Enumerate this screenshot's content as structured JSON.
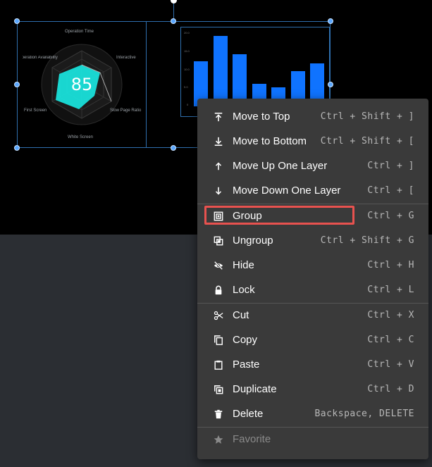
{
  "radar": {
    "score": "85",
    "labels": [
      "Operation Time",
      "Interactive",
      "Slow Page Ratio",
      "White Screen",
      "First Screen",
      "Operation Availability"
    ]
  },
  "bar_chart": {
    "y_ticks": [
      "20.0",
      "15.0",
      "10.0",
      "5.0",
      "0"
    ],
    "values": [
      0.4,
      0.62,
      0.46,
      0.2,
      0.17,
      0.31,
      0.38
    ]
  },
  "menu": {
    "items": [
      {
        "label": "Move to Top",
        "shortcut": "Ctrl + Shift + ]",
        "icon": "arrow-to-top-icon"
      },
      {
        "label": "Move to Bottom",
        "shortcut": "Ctrl + Shift + [",
        "icon": "arrow-to-bottom-icon"
      },
      {
        "label": "Move Up One Layer",
        "shortcut": "Ctrl + ]",
        "icon": "arrow-up-icon"
      },
      {
        "label": "Move Down One Layer",
        "shortcut": "Ctrl + [",
        "icon": "arrow-down-icon"
      },
      {
        "label": "Group",
        "shortcut": "Ctrl + G",
        "icon": "group-icon"
      },
      {
        "label": "Ungroup",
        "shortcut": "Ctrl + Shift + G",
        "icon": "ungroup-icon"
      },
      {
        "label": "Hide",
        "shortcut": "Ctrl + H",
        "icon": "eye-off-icon"
      },
      {
        "label": "Lock",
        "shortcut": "Ctrl + L",
        "icon": "lock-icon"
      },
      {
        "label": "Cut",
        "shortcut": "Ctrl + X",
        "icon": "scissors-icon"
      },
      {
        "label": "Copy",
        "shortcut": "Ctrl + C",
        "icon": "copy-icon"
      },
      {
        "label": "Paste",
        "shortcut": "Ctrl + V",
        "icon": "paste-icon"
      },
      {
        "label": "Duplicate",
        "shortcut": "Ctrl + D",
        "icon": "duplicate-icon"
      },
      {
        "label": "Delete",
        "shortcut": "Backspace, DELETE",
        "icon": "trash-icon"
      },
      {
        "label": "Favorite",
        "shortcut": "",
        "icon": "star-icon",
        "disabled": true
      }
    ]
  },
  "colors": {
    "accent": "#0f73ff",
    "highlight": "#e8524f",
    "menu_bg": "#3a3a3a"
  }
}
